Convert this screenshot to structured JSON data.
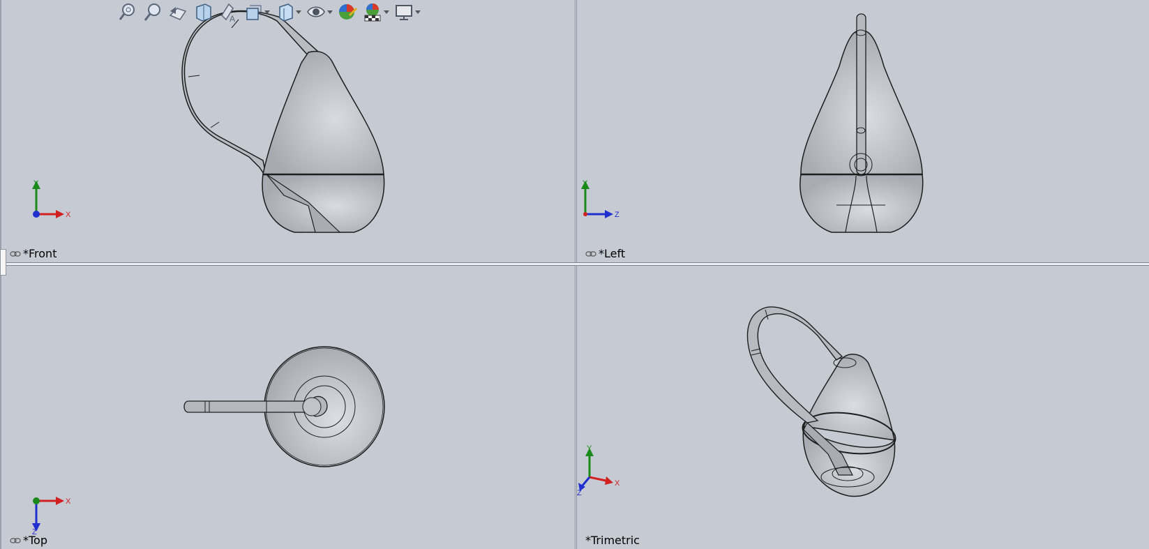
{
  "views": {
    "front": {
      "label": "*Front"
    },
    "left": {
      "label": "*Left"
    },
    "top": {
      "label": "*Top"
    },
    "trimetric": {
      "label": "*Trimetric"
    }
  },
  "triads": {
    "front": {
      "a": "Y",
      "b": "X"
    },
    "left": {
      "a": "Y",
      "b": "Z"
    },
    "top": {
      "a": "X",
      "b": "Z"
    },
    "trimetric": {
      "a": "Y",
      "b": "X",
      "c": "Z"
    }
  },
  "toolbar": {
    "items": [
      {
        "icon": "zoom-to-fit-icon"
      },
      {
        "icon": "zoom-to-area-icon"
      },
      {
        "icon": "previous-view-icon"
      },
      {
        "icon": "section-view-icon"
      },
      {
        "icon": "view-orientation-icon"
      },
      {
        "icon": "display-style-icon"
      },
      {
        "icon": "hide-show-items-icon"
      },
      {
        "icon": "edit-appearance-icon"
      },
      {
        "icon": "apply-scene-icon"
      },
      {
        "icon": "view-settings-icon"
      }
    ]
  },
  "colors": {
    "background": "#c6cad3",
    "model_fill": "#b5b8bf",
    "edge": "#1d1d1d",
    "axis_x": "#d22020",
    "axis_y": "#1a8a1a",
    "axis_z": "#1f2fd0"
  }
}
